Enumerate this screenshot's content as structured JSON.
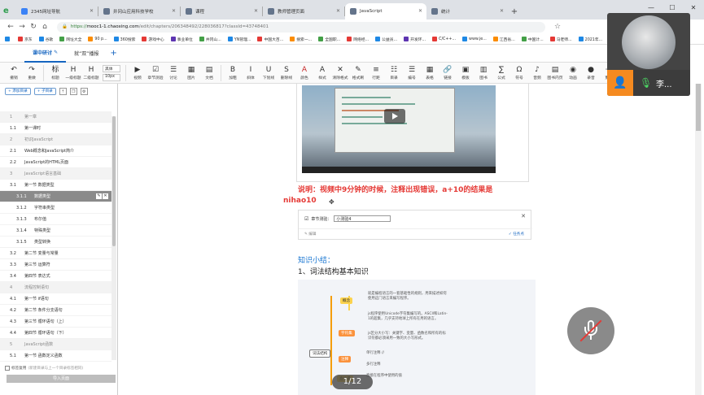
{
  "browser": {
    "tabs": [
      {
        "label": "2345网址导航",
        "color": "#3b82f6"
      },
      {
        "label": "井冈山应用科技学校",
        "color": "#64748b"
      },
      {
        "label": "课程",
        "color": "#64748b"
      },
      {
        "label": "教师管理页面",
        "color": "#64748b"
      },
      {
        "label": "JavaScript",
        "color": "#64748b",
        "active": true
      },
      {
        "label": "统计",
        "color": "#64748b"
      }
    ],
    "url_host": "mooc1-1.chaoxing.com",
    "url_path": "/edit/chapters/206348492/228036817?classId=43748401",
    "url_scheme": "https://",
    "bookmarks": [
      "京东",
      "谷歌",
      "网址大全",
      "90 p...",
      "360搜索",
      "游戏中心",
      "事业单位",
      "井冈山...",
      "YN管理...",
      "中国大百...",
      "搜索一...",
      "全国职...",
      "网络经...",
      "公益员...",
      "开发环...",
      "C/C++...",
      "www.je...",
      "江西省...",
      "中国计...",
      "马老师...",
      "2021年..."
    ]
  },
  "app": {
    "tabs": [
      {
        "label": "课中研讨"
      },
      {
        "label": "就“双”播报"
      }
    ]
  },
  "toolbar": {
    "items": [
      {
        "label": "撤销",
        "glyph": "↶"
      },
      {
        "label": "重做",
        "glyph": "↷"
      },
      {
        "label": "标题",
        "glyph": "标"
      },
      {
        "label": "一级标题",
        "glyph": "H"
      },
      {
        "label": "二级标题",
        "glyph": "H"
      },
      {
        "label": "视频",
        "glyph": "▶"
      },
      {
        "label": "章节测验",
        "glyph": "☑"
      },
      {
        "label": "讨论",
        "glyph": "☰"
      },
      {
        "label": "图片",
        "glyph": "▦"
      },
      {
        "label": "文档",
        "glyph": "▤"
      },
      {
        "label": "加粗",
        "glyph": "B"
      },
      {
        "label": "斜体",
        "glyph": "I"
      },
      {
        "label": "下划线",
        "glyph": "U"
      },
      {
        "label": "删除线",
        "glyph": "S"
      },
      {
        "label": "颜色",
        "glyph": "A"
      },
      {
        "label": "样式",
        "glyph": "A"
      },
      {
        "label": "清除格式",
        "glyph": "✕"
      },
      {
        "label": "格式刷",
        "glyph": "✎"
      },
      {
        "label": "行距",
        "glyph": "≡"
      },
      {
        "label": "目录",
        "glyph": "☷"
      },
      {
        "label": "编号",
        "glyph": "☰"
      },
      {
        "label": "表格",
        "glyph": "▦"
      },
      {
        "label": "链接",
        "glyph": "🔗"
      },
      {
        "label": "模板",
        "glyph": "▣"
      },
      {
        "label": "图书",
        "glyph": "▥"
      },
      {
        "label": "公式",
        "glyph": "∑"
      },
      {
        "label": "符号",
        "glyph": "Ω"
      },
      {
        "label": "音频",
        "glyph": "♪"
      },
      {
        "label": "图书内页",
        "glyph": "▤"
      },
      {
        "label": "动画",
        "glyph": "◉"
      },
      {
        "label": "录音",
        "glyph": "●"
      },
      {
        "label": "更多",
        "glyph": "⋯"
      }
    ],
    "font_select": "黑体",
    "size_select": "10px"
  },
  "left_panel": {
    "add_dir": "+ 添加目录",
    "add_child": "+ 子目录",
    "items": [
      {
        "num": "1",
        "label": "第一章",
        "type": "sec"
      },
      {
        "num": "1.1",
        "label": "第一课时",
        "type": "sub"
      },
      {
        "num": "2",
        "label": "初识JavaScript",
        "type": "sec"
      },
      {
        "num": "2.1",
        "label": "Web概念和JavaScript简介",
        "type": "sub"
      },
      {
        "num": "2.2",
        "label": "JavaScript的HTML页面",
        "type": "sub"
      },
      {
        "num": "3",
        "label": "JavaScript语言基础",
        "type": "sec"
      },
      {
        "num": "3.1",
        "label": "第一节 数据类型",
        "type": "sub"
      },
      {
        "num": "3.1.1",
        "label": "数据类型",
        "type": "sub2",
        "selected": true
      },
      {
        "num": "3.1.2",
        "label": "字符串类型",
        "type": "sub2"
      },
      {
        "num": "3.1.3",
        "label": "布尔值",
        "type": "sub2"
      },
      {
        "num": "3.1.4",
        "label": "特殊类型",
        "type": "sub2"
      },
      {
        "num": "3.1.5",
        "label": "类型转换",
        "type": "sub2"
      },
      {
        "num": "3.2",
        "label": "第二节 变量与常量",
        "type": "sub"
      },
      {
        "num": "3.3",
        "label": "第三节 运算符",
        "type": "sub"
      },
      {
        "num": "3.4",
        "label": "第四节 表达式",
        "type": "sub"
      },
      {
        "num": "4",
        "label": "流程控制语句",
        "type": "sec"
      },
      {
        "num": "4.1",
        "label": "第一节 if语句",
        "type": "sub"
      },
      {
        "num": "4.2",
        "label": "第二节 条件分支语句",
        "type": "sub"
      },
      {
        "num": "4.3",
        "label": "第三节 循环语句（上）",
        "type": "sub"
      },
      {
        "num": "4.4",
        "label": "第四节 循环语句（下）",
        "type": "sub"
      },
      {
        "num": "5",
        "label": "JavaScript函数",
        "type": "sec"
      },
      {
        "num": "5.1",
        "label": "第一节 函数定义函数",
        "type": "sub"
      }
    ],
    "foot_checkbox": "标签复用",
    "foot_hint": "(新建目录与上一个目录标签相同)",
    "import_button": "导入页面"
  },
  "editor": {
    "note_line1": "说明：视频中9分钟的时候，注释出现错误，a+10的结果是",
    "note_line2": "nihao10",
    "quiz_label": "章节测验：",
    "quiz_value": "小测验4",
    "quiz_edit": "✎ 编辑",
    "quiz_task": "✓ 任务点",
    "section_title": "知识小结：",
    "subsection_title": "1、词法结构基本知识",
    "mindmap": {
      "root": "词法结构",
      "nodes": [
        "概念",
        "字符集",
        "注释",
        "直接量"
      ],
      "texts": [
        "就是编程语言的一套基础性的规则，用来描述如何使用这门语言来编写程序。",
        "js程序使用Unicode字符集编写的。ASCII和Latin-1的超集，几乎支持地球上所有在用的语言。",
        "js区分大小写：关键字、变量、函数名和所有的标识符都必须采用一致的大小写形式。",
        "单行注释 //",
        "多行注释",
        "直接在程序中使用的值"
      ]
    },
    "page_indicator": "1/12"
  },
  "call": {
    "participant_name": "李..."
  }
}
